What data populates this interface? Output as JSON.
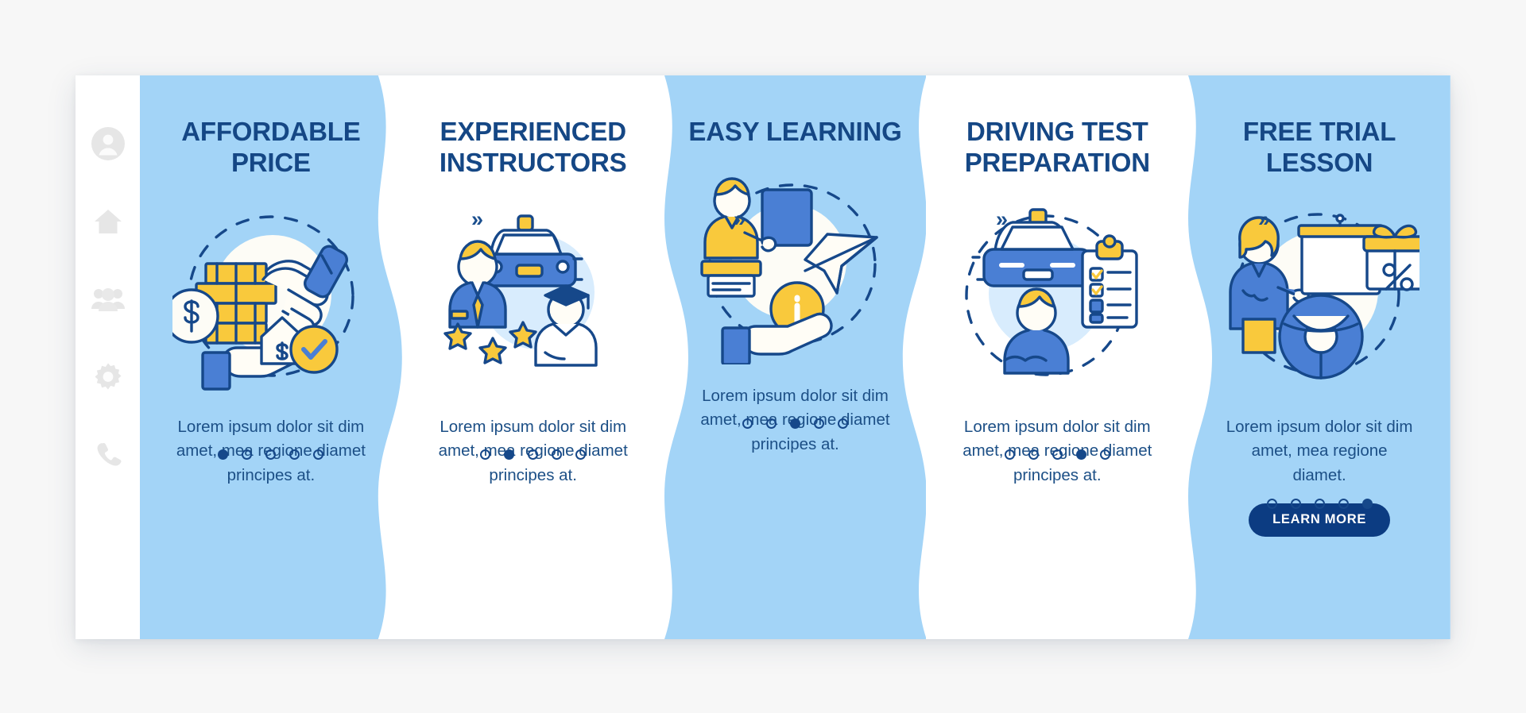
{
  "app": {
    "background_color": "#f7f7f7",
    "accent_blue": "#a3d4f7",
    "accent_navy": "#16488a",
    "accent_yellow": "#f9c93c",
    "accent_mid_blue": "#4a7fd4"
  },
  "sidebar": {
    "items": [
      {
        "icon": "user-avatar-icon",
        "label": "Account"
      },
      {
        "icon": "home-icon",
        "label": "Home"
      },
      {
        "icon": "people-group-icon",
        "label": "Community"
      },
      {
        "icon": "gear-icon",
        "label": "Settings"
      },
      {
        "icon": "phone-icon",
        "label": "Contact"
      }
    ]
  },
  "separators": [
    {
      "glyph": "»"
    },
    {
      "glyph": "»"
    },
    {
      "glyph": "»"
    },
    {
      "glyph": "»"
    }
  ],
  "panels": [
    {
      "title": "AFFORDABLE PRICE",
      "body": "Lorem ipsum dolor sit dim amet, mea regione diamet principes at.",
      "illustration": "handshake-coins-house-illustration",
      "theme": "blue",
      "dots_total": 5,
      "dots_active": 1,
      "cta": null
    },
    {
      "title": "EXPERIENCED INSTRUCTORS",
      "body": "Lorem ipsum dolor sit dim amet, mea regione diamet principes at.",
      "illustration": "instructor-car-graduate-illustration",
      "theme": "white",
      "dots_total": 5,
      "dots_active": 2,
      "cta": null
    },
    {
      "title": "EASY LEARNING",
      "body": "Lorem ipsum dolor sit dim amet, mea regione diamet principes at.",
      "illustration": "teacher-board-paperplane-info-illustration",
      "theme": "blue",
      "dots_total": 5,
      "dots_active": 3,
      "cta": null
    },
    {
      "title": "DRIVING TEST PREPARATION",
      "body": "Lorem ipsum dolor sit dim amet, mea regione diamet principes at.",
      "illustration": "car-checklist-driver-illustration",
      "theme": "white",
      "dots_total": 5,
      "dots_active": 4,
      "cta": null
    },
    {
      "title": "FREE TRIAL LESSON",
      "body": "Lorem ipsum dolor sit dim amet, mea regione diamet.",
      "illustration": "teacher-gift-discount-steeringwheel-illustration",
      "theme": "blue",
      "dots_total": 5,
      "dots_active": 5,
      "cta": "LEARN MORE"
    }
  ]
}
